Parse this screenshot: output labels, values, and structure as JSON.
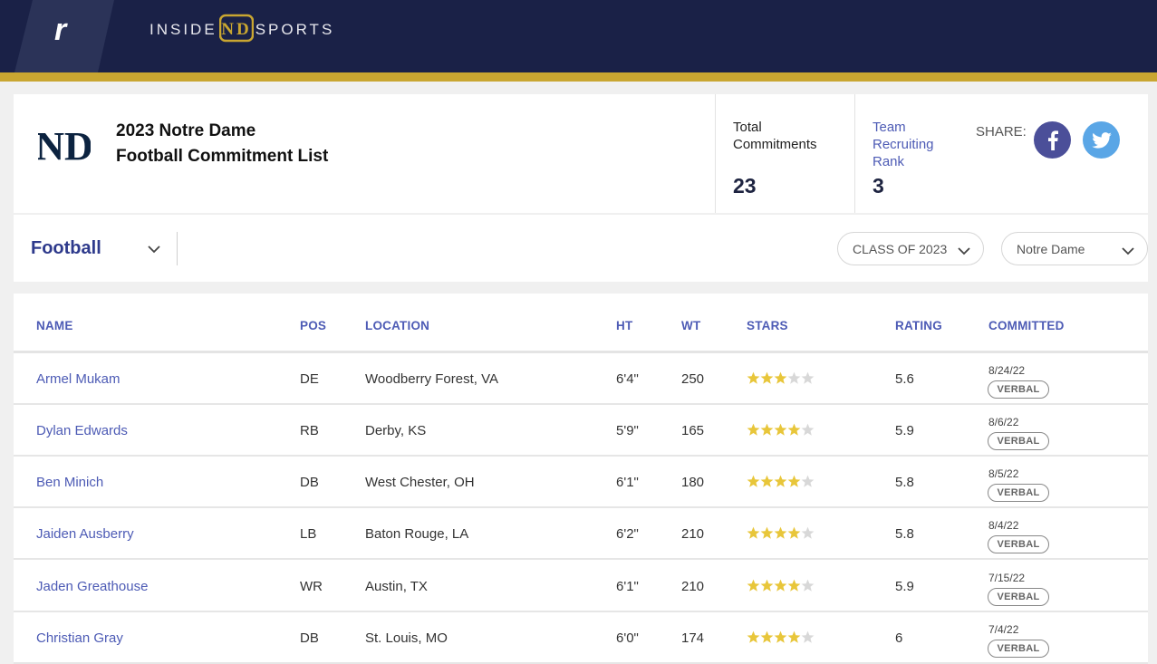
{
  "header": {
    "brand_left": "INSIDE",
    "brand_mark": "ND",
    "brand_right": "SPORTS",
    "rivals_logo": "r",
    "colors": {
      "navy": "#1a2147",
      "gold": "#c9a631"
    }
  },
  "summary": {
    "logo_text": "ND",
    "title_line1": "2023 Notre Dame",
    "title_line2": "Football Commitment List",
    "total_label_line1": "Total",
    "total_label_line2": "Commitments",
    "total_value": "23",
    "rank_label_line1": "Team",
    "rank_label_line2": "Recruiting",
    "rank_label_line3": "Rank",
    "rank_value": "3",
    "share_label": "SHARE:",
    "facebook_icon": "facebook-icon",
    "twitter_icon": "twitter-icon"
  },
  "filters": {
    "sport": "Football",
    "class": "CLASS OF 2023",
    "team": "Notre Dame"
  },
  "table": {
    "columns": {
      "name": "NAME",
      "pos": "POS",
      "location": "LOCATION",
      "ht": "HT",
      "wt": "WT",
      "stars": "STARS",
      "rating": "RATING",
      "committed": "COMMITTED"
    },
    "rows": [
      {
        "name": "Armel Mukam",
        "pos": "DE",
        "location": "Woodberry Forest, VA",
        "ht": "6'4\"",
        "wt": "250",
        "stars": 3,
        "rating": "5.6",
        "date": "8/24/22",
        "status": "VERBAL"
      },
      {
        "name": "Dylan Edwards",
        "pos": "RB",
        "location": "Derby, KS",
        "ht": "5'9\"",
        "wt": "165",
        "stars": 4,
        "rating": "5.9",
        "date": "8/6/22",
        "status": "VERBAL"
      },
      {
        "name": "Ben Minich",
        "pos": "DB",
        "location": "West Chester, OH",
        "ht": "6'1\"",
        "wt": "180",
        "stars": 4,
        "rating": "5.8",
        "date": "8/5/22",
        "status": "VERBAL"
      },
      {
        "name": "Jaiden Ausberry",
        "pos": "LB",
        "location": "Baton Rouge, LA",
        "ht": "6'2\"",
        "wt": "210",
        "stars": 4,
        "rating": "5.8",
        "date": "8/4/22",
        "status": "VERBAL"
      },
      {
        "name": "Jaden Greathouse",
        "pos": "WR",
        "location": "Austin, TX",
        "ht": "6'1\"",
        "wt": "210",
        "stars": 4,
        "rating": "5.9",
        "date": "7/15/22",
        "status": "VERBAL"
      },
      {
        "name": "Christian Gray",
        "pos": "DB",
        "location": "St. Louis, MO",
        "ht": "6'0\"",
        "wt": "174",
        "stars": 4,
        "rating": "6",
        "date": "7/4/22",
        "status": "VERBAL"
      }
    ],
    "star_max": 5,
    "star_color_on": "#e8c63a",
    "star_color_off": "#d8d8d8"
  }
}
